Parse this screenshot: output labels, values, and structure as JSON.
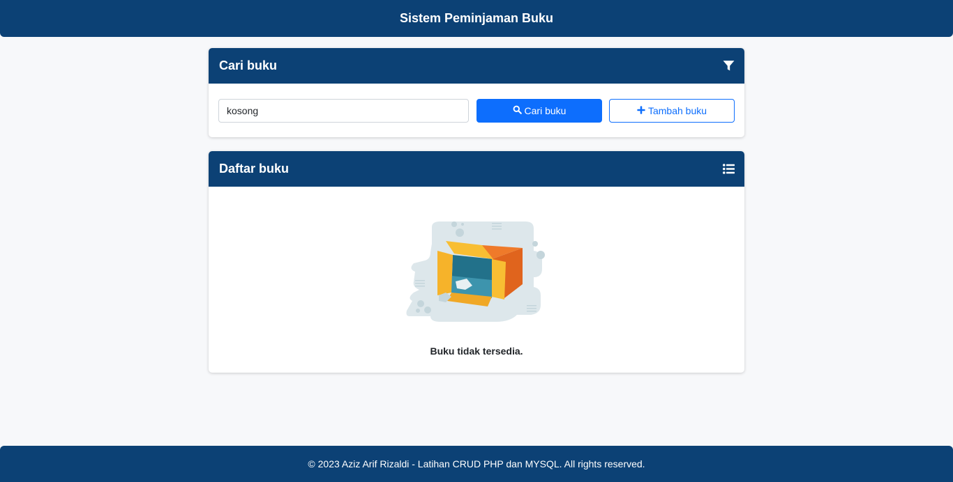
{
  "app": {
    "title": "Sistem Peminjaman Buku"
  },
  "search_card": {
    "title": "Cari buku",
    "header_icon": "filter-icon",
    "input_value": "kosong",
    "search_button_label": "Cari buku",
    "search_button_icon": "search-icon",
    "add_button_label": "Tambah buku",
    "add_button_icon": "plus-icon"
  },
  "list_card": {
    "title": "Daftar buku",
    "header_icon": "list-icon",
    "empty_illustration": "empty-box-illustration",
    "empty_message": "Buku tidak tersedia."
  },
  "footer": {
    "text": "© 2023 Aziz Arif Rizaldi - Latihan CRUD PHP dan MYSQL. All rights reserved."
  },
  "colors": {
    "header_bg": "#0c4175",
    "primary": "#0d6efd",
    "page_bg": "#f7f8fa"
  }
}
